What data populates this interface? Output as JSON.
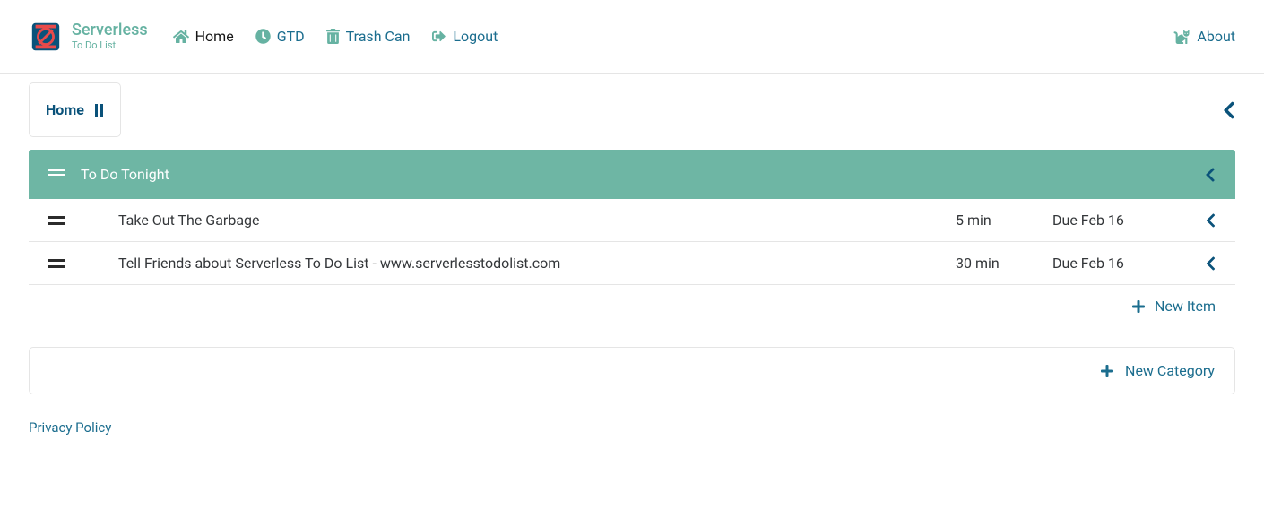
{
  "brand": {
    "title": "Serverless",
    "subtitle": "To Do List"
  },
  "nav": {
    "home": "Home",
    "gtd": "GTD",
    "trash": "Trash Can",
    "logout": "Logout",
    "about": "About"
  },
  "breadcrumb": {
    "label": "Home"
  },
  "category": {
    "title": "To Do Tonight"
  },
  "tasks": [
    {
      "title": "Take Out The Garbage",
      "estimate": "5 min",
      "due": "Due Feb 16"
    },
    {
      "title": "Tell Friends about Serverless To Do List - www.serverlesstodolist.com",
      "estimate": "30 min",
      "due": "Due Feb 16"
    }
  ],
  "actions": {
    "new_item": "New Item",
    "new_category": "New Category"
  },
  "footer": {
    "privacy": "Privacy Policy"
  }
}
